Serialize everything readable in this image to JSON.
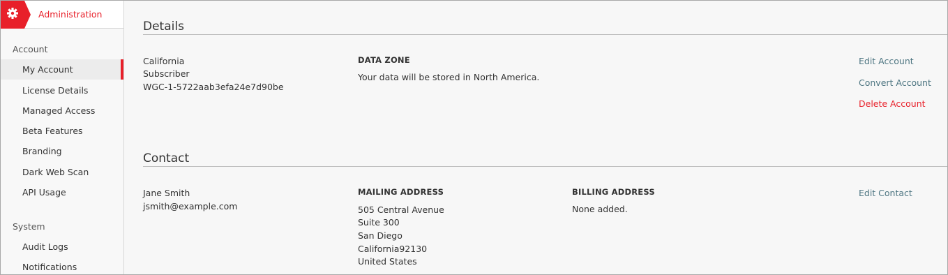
{
  "app": {
    "title": "Administration",
    "accent": "#e8202a"
  },
  "sidebar": {
    "sections": [
      {
        "label": "Account"
      },
      {
        "label": "System"
      }
    ],
    "account_items": [
      {
        "label": "My Account",
        "active": true
      },
      {
        "label": "License Details"
      },
      {
        "label": "Managed Access"
      },
      {
        "label": "Beta Features"
      },
      {
        "label": "Branding"
      },
      {
        "label": "Dark Web Scan"
      },
      {
        "label": "API Usage"
      }
    ],
    "system_items": [
      {
        "label": "Audit Logs"
      },
      {
        "label": "Notifications"
      }
    ]
  },
  "details": {
    "heading": "Details",
    "info_lines": [
      "California",
      "Subscriber",
      "WGC-1-5722aab3efa24e7d90be"
    ],
    "data_zone": {
      "label": "DATA ZONE",
      "value": "Your data will be stored in North America."
    },
    "actions": {
      "edit": "Edit Account",
      "convert": "Convert Account",
      "delete": "Delete Account"
    }
  },
  "contact": {
    "heading": "Contact",
    "name": "Jane Smith",
    "email": "jsmith@example.com",
    "mailing": {
      "label": "MAILING ADDRESS",
      "lines": [
        "505 Central Avenue",
        "Suite 300",
        "San Diego",
        "California92130",
        "United States"
      ]
    },
    "billing": {
      "label": "BILLING ADDRESS",
      "value": "None added."
    },
    "actions": {
      "edit": "Edit Contact"
    }
  },
  "icons": {
    "brand": "gear-icon"
  }
}
